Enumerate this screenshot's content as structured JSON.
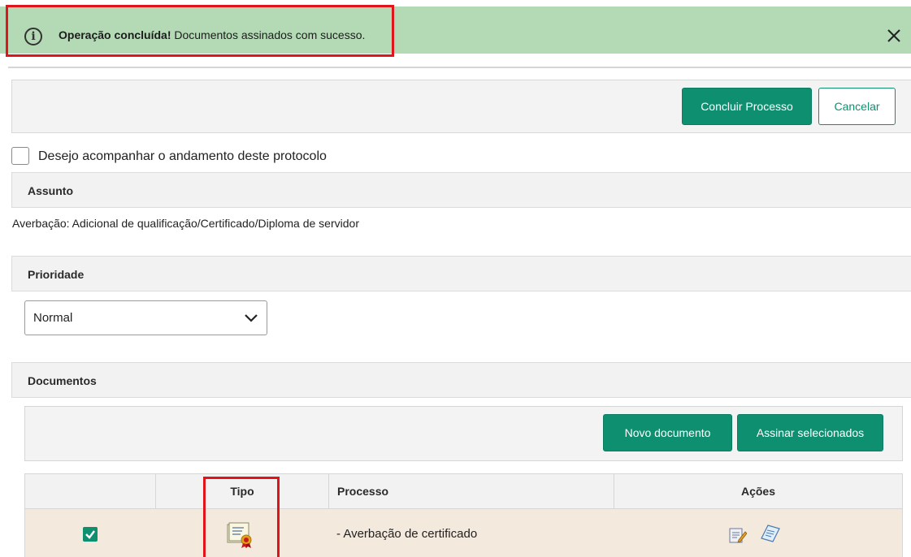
{
  "alert": {
    "icon": "info-circle-icon",
    "title": "Operação concluída!",
    "message": "Documentos assinados com sucesso.",
    "close_icon": "close-icon",
    "background": "#b3d9b5"
  },
  "toolbar": {
    "conclude_label": "Concluir Processo",
    "cancel_label": "Cancelar"
  },
  "follow": {
    "label": "Desejo acompanhar o andamento deste protocolo",
    "checked": false
  },
  "assunto": {
    "title": "Assunto",
    "value": "Averbação: Adicional de qualificação/Certificado/Diploma de servidor"
  },
  "prioridade": {
    "title": "Prioridade",
    "selected": "Normal"
  },
  "documentos": {
    "title": "Documentos",
    "new_label": "Novo documento",
    "sign_label": "Assinar selecionados",
    "columns": [
      "",
      "Tipo",
      "Processo",
      "Ações"
    ],
    "rows": [
      {
        "checked": true,
        "tipo_icon": "certificate-icon",
        "processo": "- Averbação de certificado",
        "actions": [
          "edit-document-icon",
          "view-document-icon"
        ]
      }
    ]
  },
  "colors": {
    "primary": "#0e9070",
    "highlight": "#e0141b",
    "row_background": "#f3e9dc"
  }
}
